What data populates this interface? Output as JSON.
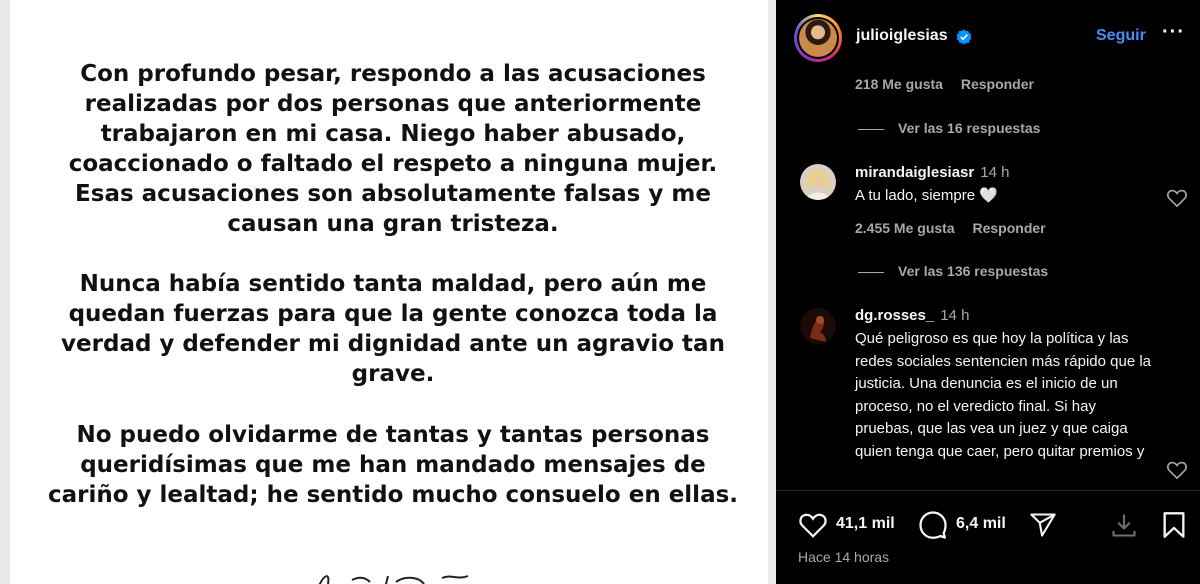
{
  "statement": {
    "paragraph1": "Con profundo pesar, respondo a las acusaciones realizadas por dos personas que anteriormente trabajaron en mi casa. Niego haber abusado, coaccionado o faltado el respeto a ninguna mujer. Esas acusaciones son absolutamente falsas y me causan una gran tristeza.",
    "paragraph2": "Nunca había sentido tanta maldad, pero aún me quedan fuerzas para que la gente conozca toda la verdad y defender mi dignidad ante un agravio tan grave.",
    "paragraph3": "No puedo olvidarme de tantas y tantas personas queridísimas que me han mandado mensajes de cariño y lealtad; he sentido mucho consuelo en ellas."
  },
  "header": {
    "username": "julioiglesias",
    "verified": true,
    "follow_label": "Seguir",
    "more_label": "···"
  },
  "comments": {
    "prev_likes": "218 Me gusta",
    "prev_reply_label": "Responder",
    "prev_replies": "Ver las 16 respuestas",
    "items": [
      {
        "username": "mirandaiglesiasr",
        "time": "14 h",
        "text": "A tu lado, siempre 🤍",
        "likes": "2.455 Me gusta",
        "reply_label": "Responder",
        "replies": "Ver las 136 respuestas"
      },
      {
        "username": "dg.rosses_",
        "time": "14 h",
        "text": "Qué peligroso es que hoy la política y las redes sociales sentencien más rápido que la justicia. Una denuncia es el inicio de un proceso, no el veredicto final. Si hay pruebas, que las vea un juez y que caiga quien tenga que caer, pero quitar premios y"
      }
    ]
  },
  "actions": {
    "like_count": "41,1 mil",
    "comment_count": "6,4 mil",
    "time_ago": "Hace 14 horas",
    "icons": [
      "heart-icon",
      "comment-icon",
      "share-icon",
      "save-icon",
      "bookmark-icon"
    ]
  },
  "colors": {
    "panel_bg": "#000000",
    "accent_blue": "#4a8df8",
    "muted_text": "#a8a8a8",
    "text": "#f5f5f5"
  }
}
